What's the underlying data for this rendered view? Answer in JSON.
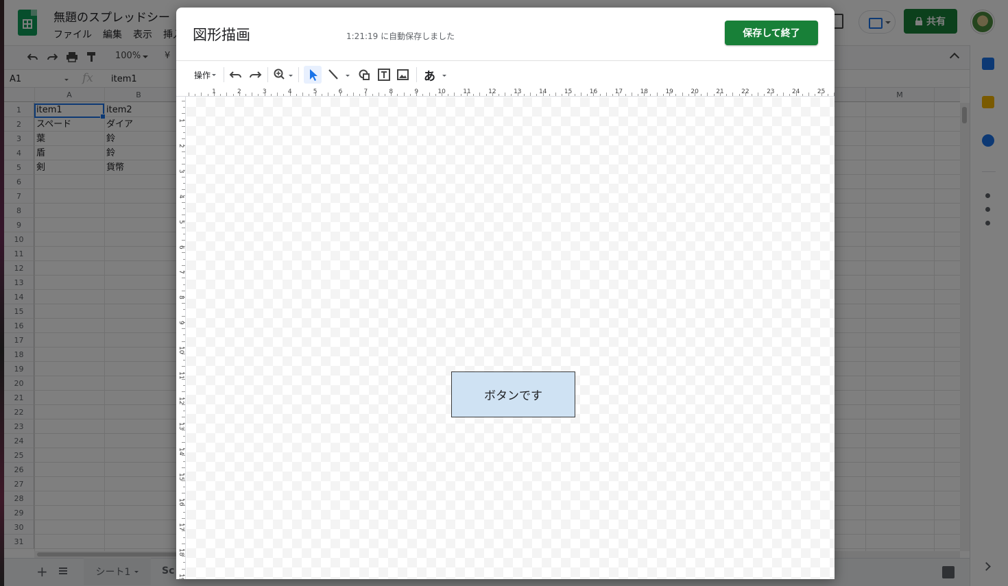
{
  "sheets": {
    "doc_title": "無題のスプレッドシー",
    "menu": [
      "ファイル",
      "編集",
      "表示",
      "挿入"
    ],
    "zoom": "100%",
    "currency": "¥",
    "share_label": "共有",
    "name_box": "A1",
    "fx_label": "fx",
    "formula_value": "item1",
    "columns": [
      "A",
      "B",
      "M"
    ],
    "rows": [
      "1",
      "2",
      "3",
      "4",
      "5",
      "6",
      "7",
      "8",
      "9",
      "10",
      "11",
      "12",
      "13",
      "14",
      "15",
      "16",
      "17",
      "18",
      "19",
      "20",
      "21",
      "22",
      "23",
      "24",
      "25",
      "26",
      "27",
      "28",
      "29",
      "30",
      "31"
    ],
    "cells": [
      [
        "item1",
        "item2"
      ],
      [
        "スペード",
        "ダイア"
      ],
      [
        "葉",
        "鈴"
      ],
      [
        "盾",
        "鈴"
      ],
      [
        "剣",
        "貨幣"
      ]
    ],
    "sheet_tab": "シート1",
    "sheet_tab_partial": "Sc"
  },
  "dialog": {
    "title": "図形描画",
    "autosave": "1:21:19 に自動保存しました",
    "save_button": "保存して終了",
    "actions_menu": "操作",
    "text_style_glyph": "あ",
    "ruler_h": [
      "1",
      "2",
      "3",
      "4",
      "5",
      "6",
      "7",
      "8",
      "9",
      "10",
      "11",
      "12",
      "13",
      "14",
      "15",
      "16",
      "17",
      "18",
      "19",
      "20",
      "21",
      "22",
      "23",
      "24",
      "25"
    ],
    "ruler_v": [
      "1",
      "2",
      "3",
      "4",
      "5",
      "6",
      "7",
      "8",
      "9",
      "10",
      "11",
      "12",
      "13",
      "14",
      "15",
      "16",
      "17",
      "18",
      "19"
    ],
    "shape_text": "ボタンです",
    "shape_fill": "#cfe2f3"
  },
  "icons": [
    "undo-icon",
    "redo-icon",
    "print-icon",
    "paint-format-icon",
    "zoom-icon",
    "select-arrow-icon",
    "line-icon",
    "shape-icon",
    "textbox-icon",
    "image-icon",
    "calendar-icon",
    "keep-icon",
    "tasks-icon"
  ]
}
